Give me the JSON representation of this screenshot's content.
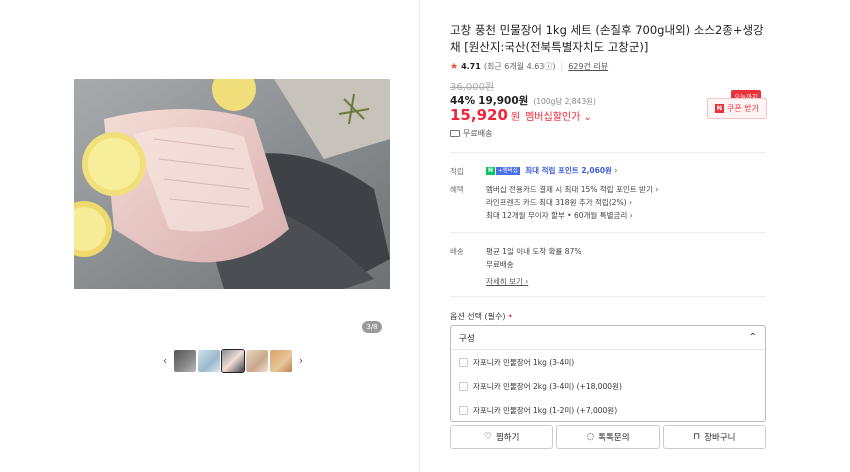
{
  "gallery": {
    "counter": "3/8",
    "prev_arrow": "‹",
    "next_arrow": "›",
    "thumbnails": 5,
    "active_thumbnail": 3
  },
  "product": {
    "title": "고창 풍천 민물장어 1kg 세트 (손질후 700g내외) 소스2종+생강채 [원산지:국산(전북특별자치도 고창군)]",
    "rating": "4.71",
    "rating_detail": "(최근 6개월 4.63ⓘ)",
    "review_count": "629건 리뷰",
    "original_price": "36,000원",
    "discount_pct": "44%",
    "sale_price": "19,900원",
    "unit_price": "(100g당 2,843원)",
    "member_price": "15,920",
    "member_price_won": "원",
    "member_label": "멤버십할인가 ⌄",
    "free_shipping": "무료배송"
  },
  "coupon": {
    "today_badge": "오늘까지",
    "n_mark": "N",
    "label": "쿠폰 받기"
  },
  "benefits": {
    "points_label": "적립",
    "points_badge_n": "N",
    "points_badge_plus": "+멤버십",
    "points_text": "최대 적립 포인트 2,060원",
    "points_chevron": "›",
    "perks_label": "혜택",
    "perks": [
      "멤버십 전용카드 결제 시 최대 15% 적립 포인트 받기 ›",
      "라인프렌즈 카드 최대 318원 추가 적립(2%) ›",
      "최대 12개월 무이자 할부 • 60개월 특별금리 ›"
    ]
  },
  "delivery": {
    "label": "배송",
    "line1": "평균 1일 이내 도착 확률 87%",
    "line2": "무료배송",
    "detail_link": "자세히 보기 ›"
  },
  "options": {
    "label": "옵션 선택 (필수)",
    "required_mark": "•",
    "group_name": "구성",
    "chevron": "⌃",
    "items": [
      "자포니카 민물장어 1kg (3-4미)",
      "자포니카 민물장어 2kg (3-4미) (+18,000원)",
      "자포니카 민물장어 1kg (1-2미) (+7,000원)"
    ]
  },
  "actions": {
    "wish_label": "찜하기",
    "wish_icon": "♡",
    "talk_label": "톡톡문의",
    "talk_icon": "◌",
    "cart_label": "장바구니",
    "cart_icon": "⊓"
  },
  "colors": {
    "accent_red": "#f0253a",
    "point_blue": "#3b5bdb",
    "naver_green": "#03c75a"
  }
}
